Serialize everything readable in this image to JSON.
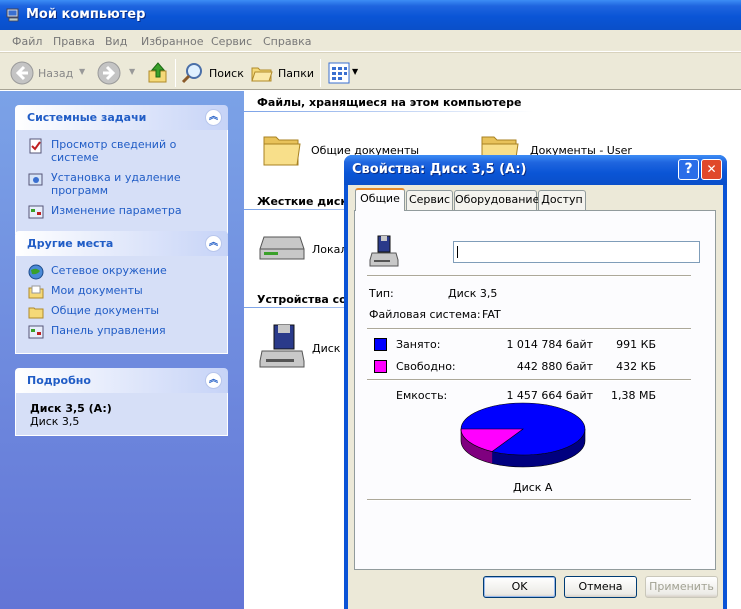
{
  "window": {
    "title": "Мой компьютер"
  },
  "menu": [
    "Файл",
    "Правка",
    "Вид",
    "Избранное",
    "Сервис",
    "Справка"
  ],
  "toolbar": {
    "back": "Назад",
    "search": "Поиск",
    "folders": "Папки"
  },
  "sidebar": {
    "system_tasks": {
      "title": "Системные задачи",
      "items": [
        "Просмотр сведений о системе",
        "Установка и удаление программ",
        "Изменение параметра"
      ]
    },
    "other_places": {
      "title": "Другие места",
      "items": [
        "Сетевое окружение",
        "Мои документы",
        "Общие документы",
        "Панель управления"
      ]
    },
    "details": {
      "title": "Подробно",
      "name": "Диск 3,5 (A:)",
      "type": "Диск 3,5"
    }
  },
  "main": {
    "files_section": "Файлы, хранящиеся на этом компьютере",
    "shared_docs": "Общие документы",
    "user_docs": "Документы - User",
    "hard_disks_section": "Жесткие диски",
    "local_disk": "Локаль",
    "devices_section": "Устройства со с",
    "floppy": "Диск 3"
  },
  "dialog": {
    "title": "Свойства: Диск 3,5 (A:)",
    "help": "?",
    "close": "✕",
    "tabs": [
      "Общие",
      "Сервис",
      "Оборудование",
      "Доступ"
    ],
    "active_tab": "Общие",
    "name_value": "",
    "type_label": "Тип:",
    "type_value": "Диск 3,5",
    "fs_label": "Файловая система:",
    "fs_value": "FAT",
    "used_label": "Занято:",
    "used_bytes": "1 014 784 байт",
    "used_short": "991 КБ",
    "free_label": "Свободно:",
    "free_bytes": "442 880 байт",
    "free_short": "432 КБ",
    "capacity_label": "Емкость:",
    "capacity_bytes": "1 457 664 байт",
    "capacity_short": "1,38 МБ",
    "disk_label": "Диск А",
    "used_color": "#0000ff",
    "free_color": "#ff00ff",
    "ok": "OK",
    "cancel": "Отмена",
    "apply": "Применить"
  },
  "chart_data": {
    "type": "pie",
    "categories": [
      "Занято",
      "Свободно"
    ],
    "values": [
      1014784,
      442880
    ]
  }
}
